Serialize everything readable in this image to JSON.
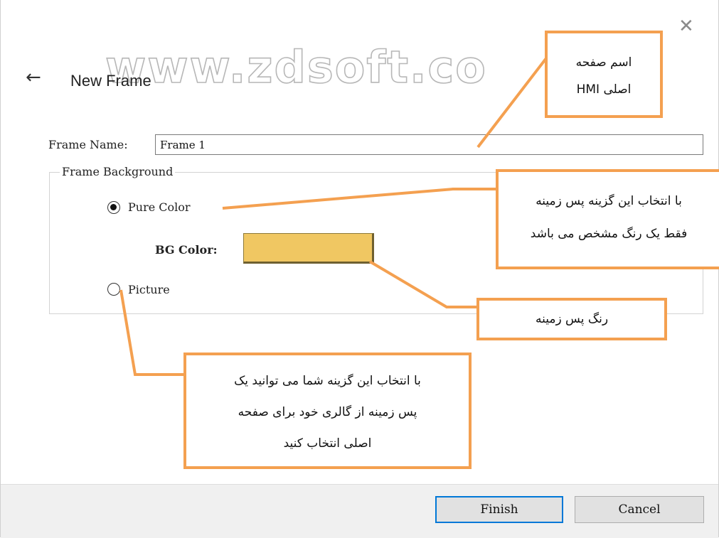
{
  "watermark": "www.zdsoft.co",
  "header": {
    "back_icon": "arrow-left-icon",
    "close_icon": "close-icon",
    "title": "New Frame"
  },
  "form": {
    "frame_name_label": "Frame Name:",
    "frame_name_value": "Frame 1",
    "background_group_label": "Frame Background",
    "pure_color_label": "Pure Color",
    "pure_color_selected": true,
    "bg_color_label": "BG Color:",
    "bg_color_value": "#f0c762",
    "picture_label": "Picture",
    "picture_selected": false
  },
  "buttons": {
    "finish": "Finish",
    "cancel": "Cancel"
  },
  "annotations": {
    "frame_name": [
      "اسم صفحه",
      "اصلی HMI"
    ],
    "pure_color": [
      "با انتخاب این گزینه پس زمینه",
      "فقط یک رنگ مشخص می باشد"
    ],
    "bg_color": [
      "رنگ پس زمینه"
    ],
    "picture": [
      "با انتخاب این گزینه شما می توانید یک",
      "پس زمینه از گالری خود برای صفحه",
      "اصلی انتخاب کنید"
    ]
  },
  "colors": {
    "callout_border": "#f4a050",
    "accent": "#0078d7",
    "footer_bg": "#f0f0f0"
  }
}
